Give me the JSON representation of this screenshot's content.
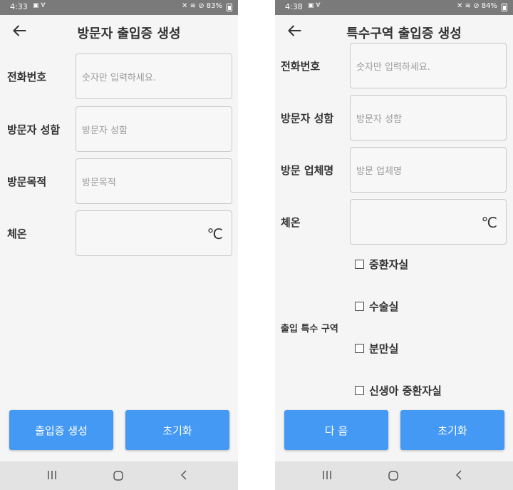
{
  "left": {
    "status": {
      "time": "4:33",
      "icons_left": "▣ Ɐ",
      "battery": "83%"
    },
    "title": "방문자 출입증 생성",
    "fields": [
      {
        "label": "전화번호",
        "placeholder": "숫자만 입력하세요.",
        "value": ""
      },
      {
        "label": "방문자 성함",
        "placeholder": "방문자 성함",
        "value": ""
      },
      {
        "label": "방문목적",
        "placeholder": "방문목적",
        "value": ""
      },
      {
        "label": "체온",
        "placeholder": "",
        "value": "",
        "unit": "℃"
      }
    ],
    "buttons": {
      "primary": "출입증 생성",
      "secondary": "초기화"
    }
  },
  "right": {
    "status": {
      "time": "4:38",
      "icons_left": "▣ Ɐ",
      "battery": "84%"
    },
    "title": "특수구역 출입증 생성",
    "fields": [
      {
        "label": "전화번호",
        "placeholder": "숫자만 입력하세요.",
        "value": ""
      },
      {
        "label": "방문자 성함",
        "placeholder": "방문자 성함",
        "value": ""
      },
      {
        "label": "방문 업체명",
        "placeholder": "방문 업체명",
        "value": ""
      },
      {
        "label": "체온",
        "placeholder": "",
        "value": "",
        "unit": "℃"
      }
    ],
    "special_area_label": "출입 특수 구역",
    "areas": [
      {
        "label": "중환자실",
        "checked": false
      },
      {
        "label": "수술실",
        "checked": false
      },
      {
        "label": "분만실",
        "checked": false
      },
      {
        "label": "신생아 중환자실",
        "checked": false
      }
    ],
    "buttons": {
      "primary": "다 음",
      "secondary": "초기화"
    }
  },
  "colors": {
    "primary_button": "#4499f5",
    "status_bar": "#7a7a7a",
    "nav_bar": "#e3e3e3"
  },
  "icons": {
    "back": "arrow-left-icon",
    "nav": [
      "recents-icon",
      "home-icon",
      "nav-back-icon"
    ]
  }
}
